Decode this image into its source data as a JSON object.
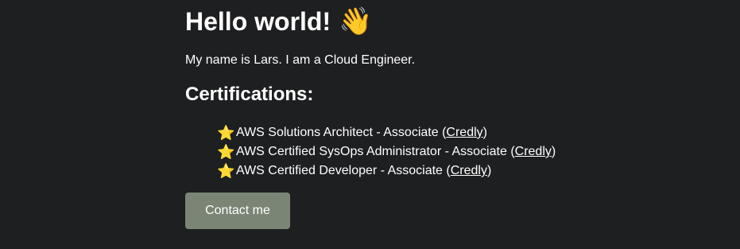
{
  "header": {
    "title": "Hello world!",
    "wave_icon": "waving-hand-emoji"
  },
  "intro": {
    "text": "My name is Lars. I am a Cloud Engineer."
  },
  "certifications": {
    "heading": "Certifications:",
    "items": [
      {
        "icon": "star-emoji",
        "label": "AWS Solutions Architect - Associate",
        "link_text": "Credly"
      },
      {
        "icon": "star-emoji",
        "label": "AWS Certified SysOps Administrator - Associate",
        "link_text": "Credly"
      },
      {
        "icon": "star-emoji",
        "label": "AWS Certified Developer - Associate",
        "link_text": "Credly"
      }
    ]
  },
  "contact": {
    "label": "Contact me"
  },
  "colors": {
    "background": "#1e1f21",
    "text": "#ffffff",
    "button": "#7a8576"
  }
}
